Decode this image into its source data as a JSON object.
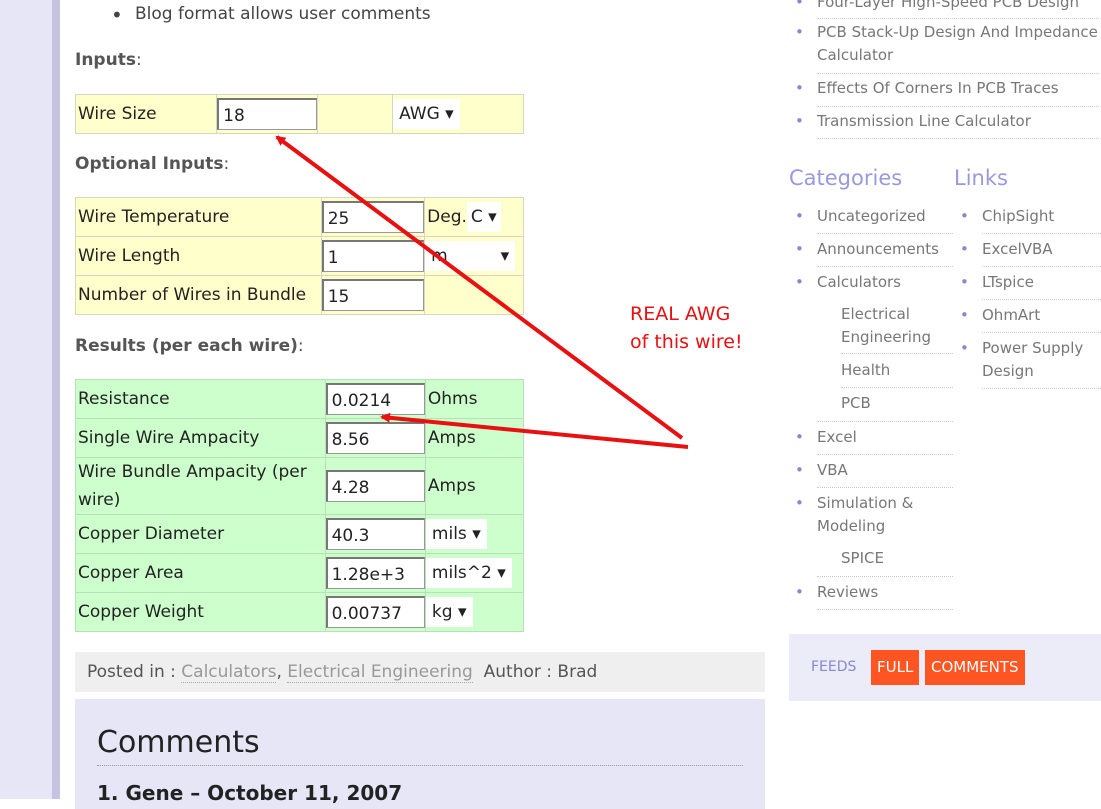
{
  "top_bullet": "Blog format allows user comments",
  "inputs": {
    "heading": "Inputs",
    "wire_size_label": "Wire Size",
    "wire_size_value": "18",
    "wire_size_unit": "AWG"
  },
  "optional": {
    "heading": "Optional Inputs",
    "rows": [
      {
        "label": "Wire Temperature",
        "value": "25",
        "unit_prefix": "Deg.",
        "unit": "C"
      },
      {
        "label": "Wire Length",
        "value": "1",
        "unit": "m"
      },
      {
        "label": "Number of Wires in Bundle",
        "value": "15"
      }
    ]
  },
  "results": {
    "heading": "Results (per each wire)",
    "rows": [
      {
        "label": "Resistance",
        "value": "0.0214",
        "unit": "Ohms"
      },
      {
        "label": "Single Wire Ampacity",
        "value": "8.56",
        "unit": "Amps"
      },
      {
        "label": "Wire Bundle Ampacity (per wire)",
        "value": "4.28",
        "unit": "Amps"
      },
      {
        "label": "Copper Diameter",
        "value": "40.3",
        "unit": "mils"
      },
      {
        "label": "Copper Area",
        "value": "1.28e+3",
        "unit": "mils^2"
      },
      {
        "label": "Copper Weight",
        "value": "0.00737",
        "unit": "kg"
      }
    ]
  },
  "posted": {
    "prefix": "Posted in",
    "cat1": "Calculators",
    "cat2": "Electrical Engineering",
    "author_label": "Author",
    "author": "Brad"
  },
  "comments": {
    "heading": "Comments",
    "first": "1.  Gene – October 11, 2007"
  },
  "annotation": {
    "line1": "REAL AWG",
    "line2": "of this wire!"
  },
  "sidebar": {
    "recent": [
      "Four-Layer High-Speed PCB Design",
      "PCB Stack-Up Design And Impedance Calculator",
      "Effects Of Corners In PCB Traces",
      "Transmission Line Calculator"
    ],
    "categories_heading": "Categories",
    "links_heading": "Links",
    "categories": [
      "Uncategorized",
      "Announcements",
      "Calculators",
      "Electrical Engineering",
      "Health",
      "PCB",
      "Excel",
      "VBA",
      "Simulation & Modeling",
      "SPICE",
      "Reviews"
    ],
    "links": [
      "ChipSight",
      "ExcelVBA",
      "LTspice",
      "OhmArt",
      "Power Supply Design"
    ],
    "feeds_label": "FEEDS",
    "feeds_full": "FULL",
    "feeds_comments": "COMMENTS"
  },
  "colors": {
    "input_bg": "#ffffcc",
    "result_bg": "#ccffcc",
    "accent": "#9999dd",
    "annotation": "#e81010",
    "feed_button": "#ff5522"
  }
}
